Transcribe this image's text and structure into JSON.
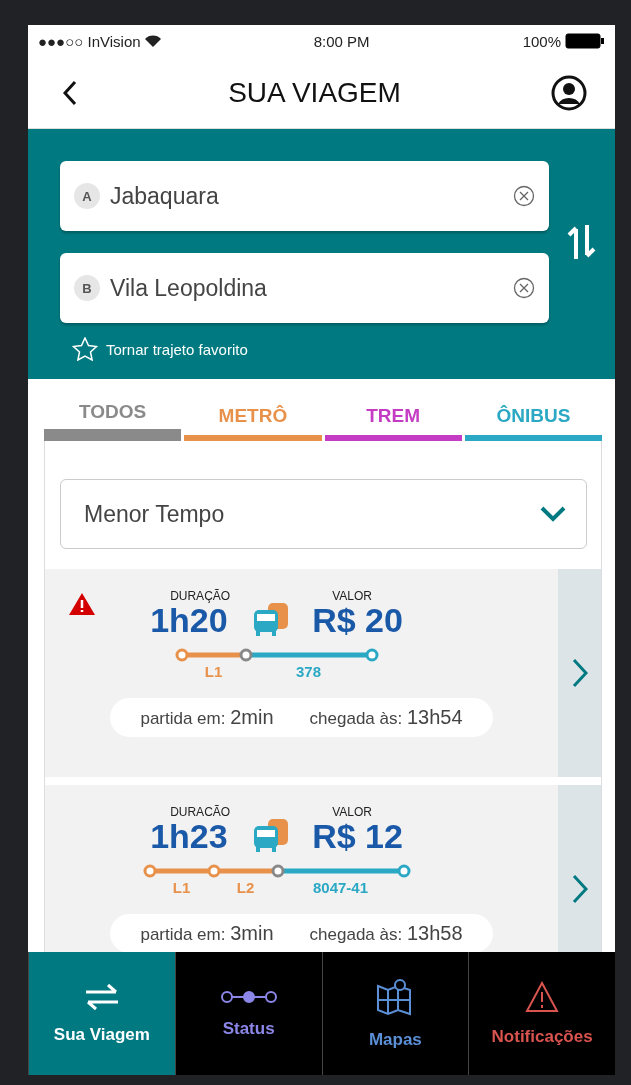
{
  "status_bar": {
    "carrier": "●●●○○ InVision",
    "time": "8:00 PM",
    "battery": "100%"
  },
  "header": {
    "title": "SUA VIAGEM"
  },
  "search": {
    "origin": {
      "badge": "A",
      "value": "Jabaquara"
    },
    "destination": {
      "badge": "B",
      "value": "Vila Leopoldina"
    },
    "favorite": "Tornar trajeto favorito"
  },
  "tabs": [
    {
      "label": "TODOS",
      "color": "#8a8a8a",
      "selected": true
    },
    {
      "label": "METRÔ",
      "color": "#e8914a",
      "selected": false
    },
    {
      "label": "TREM",
      "color": "#c43cc4",
      "selected": false
    },
    {
      "label": "ÔNIBUS",
      "color": "#2aa8c4",
      "selected": false
    }
  ],
  "sort": {
    "value": "Menor Tempo"
  },
  "routes": [
    {
      "alert": true,
      "duration_label": "DURAÇÃO",
      "duration": "1h20",
      "price_label": "VALOR",
      "price": "R$ 20",
      "legs": [
        {
          "label": "L1",
          "kind": "metro",
          "color": "#e8914a"
        },
        {
          "label": "378",
          "kind": "bus",
          "color": "#2aa8c4"
        }
      ],
      "departure_label": "partida em:",
      "departure": "2min",
      "arrival_label": "chegada às:",
      "arrival": "13h54"
    },
    {
      "alert": false,
      "duration_label": "DURACÃO",
      "duration": "1h23",
      "price_label": "VALOR",
      "price": "R$ 12",
      "legs": [
        {
          "label": "L1",
          "kind": "metro",
          "color": "#e8914a"
        },
        {
          "label": "L2",
          "kind": "metro",
          "color": "#e8914a"
        },
        {
          "label": "8047-41",
          "kind": "bus",
          "color": "#2aa8c4"
        }
      ],
      "departure_label": "partida em:",
      "departure": "3min",
      "arrival_label": "chegada às:",
      "arrival": "13h58"
    }
  ],
  "nav": [
    {
      "label": "Sua Viagem",
      "kind": "swap",
      "color": "#ffffff",
      "selected": true
    },
    {
      "label": "Status",
      "kind": "status",
      "color": "#8b86e8",
      "selected": false
    },
    {
      "label": "Mapas",
      "kind": "map",
      "color": "#5b8fd6",
      "selected": false
    },
    {
      "label": "Notificações",
      "kind": "alert",
      "color": "#d9534f",
      "selected": false
    }
  ]
}
